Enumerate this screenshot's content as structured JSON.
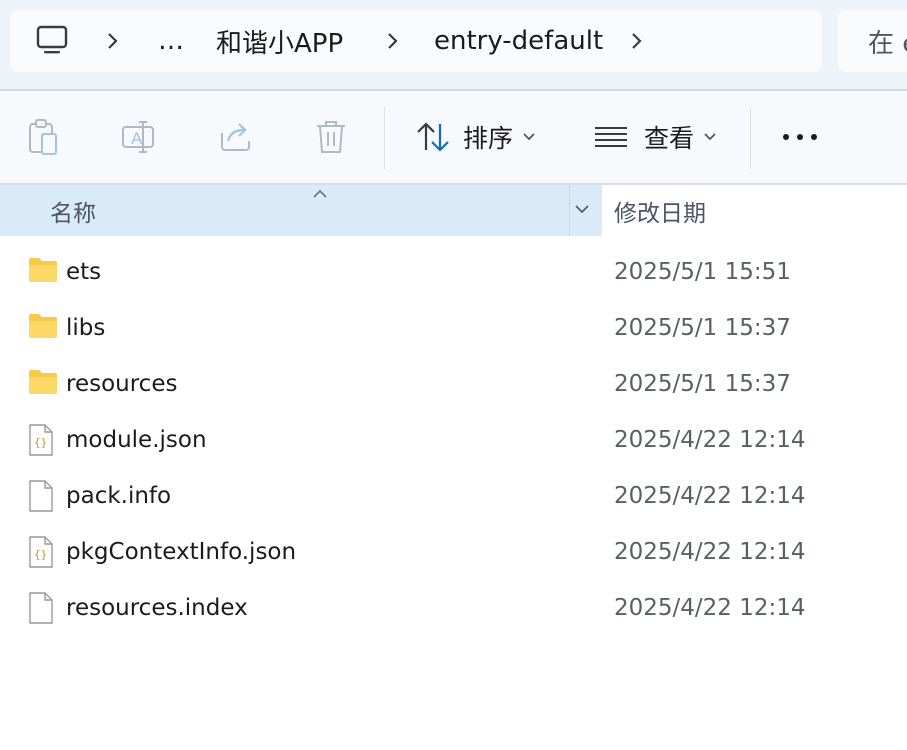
{
  "address": {
    "crumbs": [
      "…",
      "和谐小APP",
      "entry-default"
    ],
    "search_placeholder": "在 e"
  },
  "toolbar": {
    "sort_label": "排序",
    "view_label": "查看",
    "more_label": "•••"
  },
  "columns": {
    "name": "名称",
    "date_modified": "修改日期"
  },
  "files": [
    {
      "name": "ets",
      "date": "2025/5/1 15:51",
      "type": "folder"
    },
    {
      "name": "libs",
      "date": "2025/5/1 15:37",
      "type": "folder"
    },
    {
      "name": "resources",
      "date": "2025/5/1 15:37",
      "type": "folder"
    },
    {
      "name": "module.json",
      "date": "2025/4/22 12:14",
      "type": "json"
    },
    {
      "name": "pack.info",
      "date": "2025/4/22 12:14",
      "type": "file"
    },
    {
      "name": "pkgContextInfo.json",
      "date": "2025/4/22 12:14",
      "type": "json"
    },
    {
      "name": "resources.index",
      "date": "2025/4/22 12:14",
      "type": "file"
    }
  ],
  "colors": {
    "accent": "#0f6cbd",
    "header_selected": "#d9eaf8",
    "folder": "#f8c94a"
  }
}
